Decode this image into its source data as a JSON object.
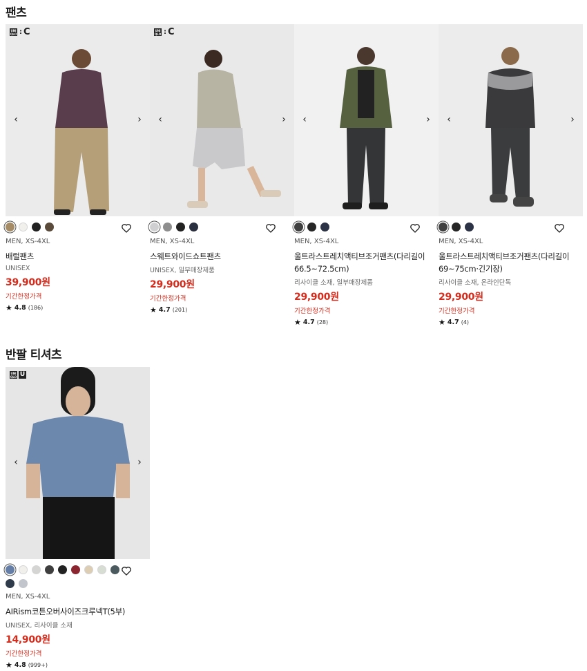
{
  "sections": [
    {
      "title": "팬츠"
    },
    {
      "title": "반팔 티셔츠"
    }
  ],
  "products": [
    {
      "logo": ":C",
      "gender_size": "MEN, XS-4XL",
      "name_lines": [
        "배럴팬츠"
      ],
      "tags": "UNISEX",
      "price": "39,900원",
      "promo": "기간한정가격",
      "rating": "4.8",
      "reviews": "(186)",
      "colors": [
        "#a58c66",
        "#f1f0ec",
        "#222222",
        "#5a4b3a"
      ]
    },
    {
      "logo": ":C",
      "gender_size": "MEN, XS-4XL",
      "name_lines": [
        "스웨트와이드쇼트팬츠"
      ],
      "tags": "UNISEX, 일부매장제품",
      "price": "29,900원",
      "promo": "기간한정가격",
      "rating": "4.7",
      "reviews": "(201)",
      "colors": [
        "#cfcfd1",
        "#8e8e8e",
        "#222222",
        "#2b3040"
      ]
    },
    {
      "logo": "",
      "gender_size": "MEN, XS-4XL",
      "name_lines": [
        "울트라스트레치액티브조거팬츠(다리길이",
        "66.5~72.5cm)"
      ],
      "tags": "리사이클 소재, 일부매장제품",
      "price": "29,900원",
      "promo": "기간한정가격",
      "rating": "4.7",
      "reviews": "(28)",
      "colors": [
        "#3f3f3f",
        "#262626",
        "#2d3346"
      ]
    },
    {
      "logo": "",
      "gender_size": "MEN, XS-4XL",
      "name_lines": [
        "울트라스트레치액티브조거팬츠(다리길이",
        "69~75cm·긴기장)"
      ],
      "tags": "리사이클 소재, 온라인단독",
      "price": "29,900원",
      "promo": "기간한정가격",
      "rating": "4.7",
      "reviews": "(4)",
      "colors": [
        "#3f3f3f",
        "#262626",
        "#2d3346"
      ]
    },
    {
      "logo": "U",
      "gender_size": "MEN, XS-4XL",
      "name_lines": [
        "AIRism코튼오버사이즈크루넥T(5부)"
      ],
      "tags": "UNISEX, 리사이클 소재",
      "price": "14,900원",
      "promo": "기간한정가격",
      "rating": "4.8",
      "reviews": "(999+)",
      "colors": [
        "#647ea8",
        "#f1f0ec",
        "#d5d5d3",
        "#3f3f3f",
        "#222222",
        "#8b2530",
        "#ddcdb3",
        "#d8ddd3",
        "#4a5a5e",
        "#2f3a4a",
        "#c2c6cc"
      ]
    }
  ],
  "icons": {
    "prev": "chevron-left-icon",
    "next": "chevron-right-icon",
    "wishlist": "heart-icon",
    "rating": "star-icon"
  }
}
